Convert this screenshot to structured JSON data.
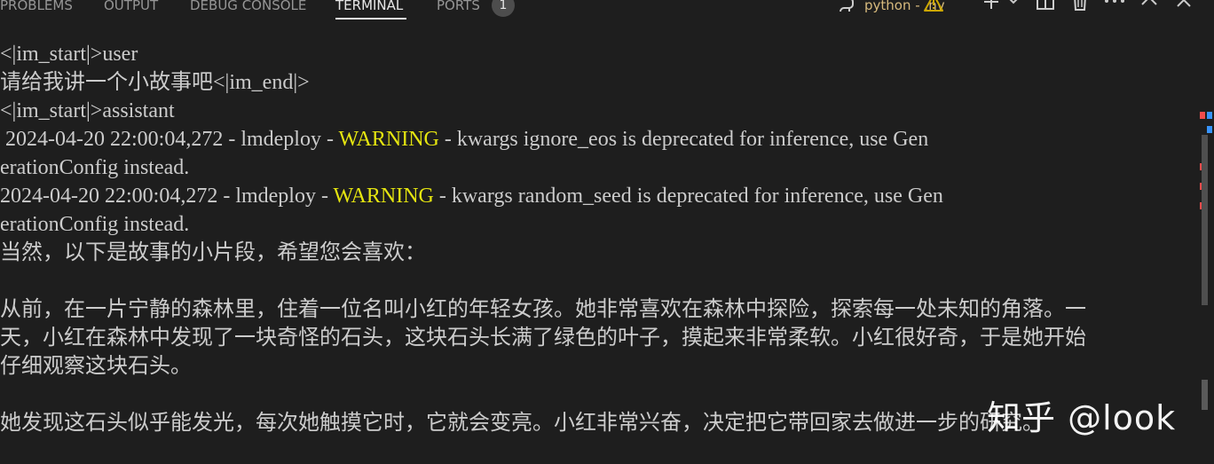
{
  "tabs": [
    {
      "label": "PROBLEMS",
      "active": false
    },
    {
      "label": "OUTPUT",
      "active": false
    },
    {
      "label": "DEBUG CONSOLE",
      "active": false
    },
    {
      "label": "TERMINAL",
      "active": true
    },
    {
      "label": "PORTS",
      "active": false
    }
  ],
  "ports_badge": "1",
  "terminal_name": "python - .nv",
  "icons": {
    "terminal_kind": "python-icon",
    "warning": "warning-icon",
    "new_terminal": "plus-icon",
    "launch_profile": "chevron-down-icon",
    "split": "split-terminal-icon",
    "kill": "trash-icon",
    "more": "more-actions-icon",
    "maximize": "chevron-up-icon",
    "close": "close-icon"
  },
  "colors": {
    "background": "#1e1e1e",
    "text": "#cccccc",
    "warning_text": "#e5e510",
    "terminal_name": "#d7ba7d",
    "overview_mark_red": "#f14c4c",
    "overview_mark_blue": "#3794ff"
  },
  "terminal": {
    "lines": [
      {
        "segments": [
          {
            "text": "<|im_start|>user"
          }
        ]
      },
      {
        "segments": [
          {
            "text": "请给我讲一个小故事吧<|im_end|>"
          }
        ]
      },
      {
        "segments": [
          {
            "text": "<|im_start|>assistant"
          }
        ]
      },
      {
        "segments": [
          {
            "text": " 2024-04-20 22:00:04,272 - lmdeploy - "
          },
          {
            "text": "WARNING",
            "warn": true
          },
          {
            "text": " - kwargs ignore_eos is deprecated for inference, use Gen"
          }
        ]
      },
      {
        "segments": [
          {
            "text": "erationConfig instead."
          }
        ]
      },
      {
        "segments": [
          {
            "text": "2024-04-20 22:00:04,272 - lmdeploy - "
          },
          {
            "text": "WARNING",
            "warn": true
          },
          {
            "text": " - kwargs random_seed is deprecated for inference, use Gen"
          }
        ]
      },
      {
        "segments": [
          {
            "text": "erationConfig instead."
          }
        ]
      },
      {
        "segments": [
          {
            "text": "当然，以下是故事的小片段，希望您会喜欢："
          }
        ]
      },
      {
        "segments": [
          {
            "text": ""
          }
        ]
      },
      {
        "segments": [
          {
            "text": "从前，在一片宁静的森林里，住着一位名叫小红的年轻女孩。她非常喜欢在森林中探险，探索每一处未知的角落。一"
          }
        ]
      },
      {
        "segments": [
          {
            "text": "天，小红在森林中发现了一块奇怪的石头，这块石头长满了绿色的叶子，摸起来非常柔软。小红很好奇，于是她开始"
          }
        ]
      },
      {
        "segments": [
          {
            "text": "仔细观察这块石头。"
          }
        ]
      },
      {
        "segments": [
          {
            "text": ""
          }
        ]
      },
      {
        "segments": [
          {
            "text": "她发现这石头似乎能发光，每次她触摸它时，它就会变亮。小红非常兴奋，决定把它带回家去做进一步的研究。"
          }
        ]
      }
    ]
  },
  "watermark": "知乎 @look"
}
